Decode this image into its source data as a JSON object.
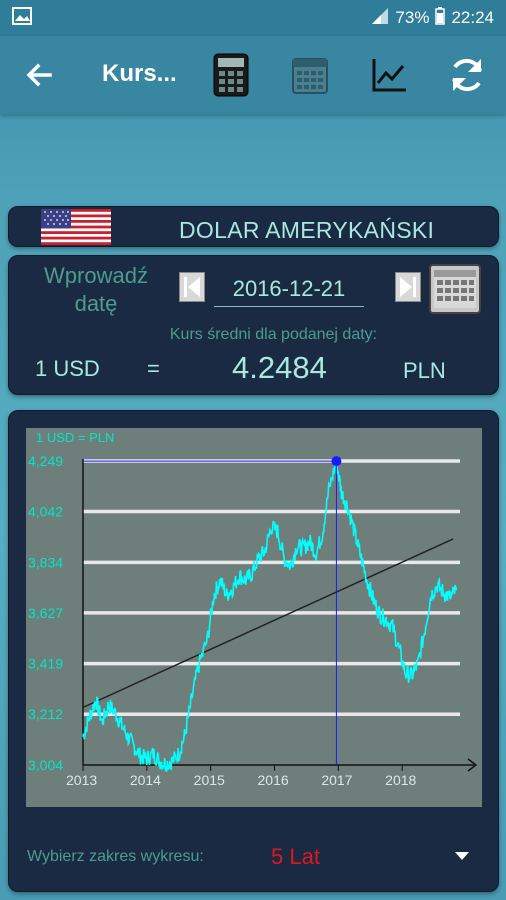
{
  "status": {
    "battery": "73%",
    "time": "22:24"
  },
  "appbar": {
    "title": "Kurs...",
    "icons": [
      "arrow-back-icon",
      "calculator-icon",
      "calendar-icon",
      "chart-icon",
      "refresh-icon"
    ]
  },
  "currency": {
    "name": "DOLAR AMERYKAŃSKI",
    "flag": "us-flag-icon"
  },
  "date": {
    "prompt_line1": "Wprowadź",
    "prompt_line2": "datę",
    "value": "2016-12-21"
  },
  "rate": {
    "label": "Kurs średni dla podanej daty:",
    "from": "1 USD",
    "equals": "=",
    "value": "4.2484",
    "to": "PLN"
  },
  "chart_data": {
    "type": "line",
    "title": "1 USD = PLN",
    "xlabel": "",
    "ylabel": "",
    "x_ticks": [
      "2013",
      "2014",
      "2015",
      "2016",
      "2017",
      "2018"
    ],
    "y_ticks": [
      "4,249",
      "4,042",
      "3,834",
      "3,627",
      "3,419",
      "3,212",
      "3,004"
    ],
    "ylim": [
      3.004,
      4.249
    ],
    "xlim": [
      2013.0,
      2019.0
    ],
    "grid": true,
    "series": [
      {
        "values": [
          [
            2013.0,
            3.12
          ],
          [
            2013.1,
            3.2
          ],
          [
            2013.2,
            3.27
          ],
          [
            2013.3,
            3.18
          ],
          [
            2013.4,
            3.25
          ],
          [
            2013.5,
            3.22
          ],
          [
            2013.6,
            3.17
          ],
          [
            2013.7,
            3.12
          ],
          [
            2013.8,
            3.08
          ],
          [
            2013.9,
            3.04
          ],
          [
            2014.0,
            3.03
          ],
          [
            2014.1,
            3.05
          ],
          [
            2014.2,
            3.02
          ],
          [
            2014.3,
            3.01
          ],
          [
            2014.4,
            3.02
          ],
          [
            2014.5,
            3.05
          ],
          [
            2014.6,
            3.13
          ],
          [
            2014.7,
            3.27
          ],
          [
            2014.8,
            3.4
          ],
          [
            2014.95,
            3.52
          ],
          [
            2015.05,
            3.7
          ],
          [
            2015.15,
            3.76
          ],
          [
            2015.25,
            3.7
          ],
          [
            2015.35,
            3.73
          ],
          [
            2015.45,
            3.78
          ],
          [
            2015.55,
            3.76
          ],
          [
            2015.65,
            3.79
          ],
          [
            2015.75,
            3.85
          ],
          [
            2015.85,
            3.88
          ],
          [
            2015.95,
            3.98
          ],
          [
            2016.05,
            3.96
          ],
          [
            2016.15,
            3.85
          ],
          [
            2016.25,
            3.82
          ],
          [
            2016.35,
            3.9
          ],
          [
            2016.45,
            3.89
          ],
          [
            2016.55,
            3.92
          ],
          [
            2016.65,
            3.87
          ],
          [
            2016.75,
            3.95
          ],
          [
            2016.85,
            4.13
          ],
          [
            2016.97,
            4.2484
          ],
          [
            2017.05,
            4.12
          ],
          [
            2017.15,
            4.06
          ],
          [
            2017.25,
            3.96
          ],
          [
            2017.35,
            3.86
          ],
          [
            2017.45,
            3.76
          ],
          [
            2017.55,
            3.68
          ],
          [
            2017.65,
            3.62
          ],
          [
            2017.75,
            3.6
          ],
          [
            2017.85,
            3.57
          ],
          [
            2017.95,
            3.48
          ],
          [
            2018.05,
            3.38
          ],
          [
            2018.15,
            3.37
          ],
          [
            2018.25,
            3.42
          ],
          [
            2018.35,
            3.55
          ],
          [
            2018.45,
            3.7
          ],
          [
            2018.55,
            3.74
          ],
          [
            2018.65,
            3.71
          ],
          [
            2018.75,
            3.69
          ],
          [
            2018.85,
            3.72
          ]
        ]
      }
    ],
    "trend": [
      [
        2013.0,
        3.24
      ],
      [
        2018.8,
        3.93
      ]
    ],
    "marker": {
      "x": 2016.97,
      "y": 4.2484
    },
    "colors": {
      "line": "#00ffff",
      "trend": "#222222",
      "marker": "#1a1aff",
      "grid": "#e8e8e8",
      "bg": "#6e7f7b",
      "axis_text": "#00e6c8"
    }
  },
  "range": {
    "label": "Wybierz zakres wykresu:",
    "value": "5 Lat"
  }
}
